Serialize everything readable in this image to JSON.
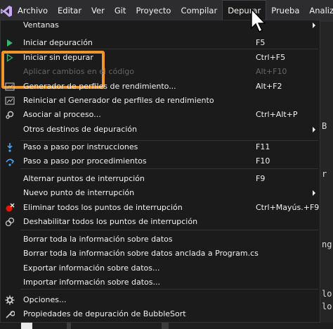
{
  "menubar": {
    "items": [
      "Archivo",
      "Editar",
      "Ver",
      "Git",
      "Proyecto",
      "Compilar",
      "Depurar",
      "Prueba",
      "Analiz"
    ],
    "active_index": 6
  },
  "editor_fragments": [
    "B",
    "r",
    "ng",
    "lo",
    "lo"
  ],
  "menu": {
    "items": [
      {
        "label": "Ventanas",
        "shortcut": "",
        "submenu": true,
        "icon": ""
      },
      {
        "label": "Iniciar depuración",
        "shortcut": "F5",
        "submenu": false,
        "icon": "play-icon"
      },
      {
        "label": "Iniciar sin depurar",
        "shortcut": "Ctrl+F5",
        "submenu": false,
        "icon": "play-outline-icon"
      },
      {
        "label": "Aplicar cambios en el código",
        "shortcut": "Alt+F10",
        "submenu": false,
        "icon": "",
        "disabled": true
      },
      {
        "label": "Generador de perfiles de rendimiento...",
        "shortcut": "Alt+F2",
        "submenu": false,
        "icon": "profiler-icon"
      },
      {
        "label": "Reiniciar el Generador de perfiles de rendimiento",
        "shortcut": "",
        "submenu": false,
        "icon": "profiler-restart-icon"
      },
      {
        "label": "Asociar al proceso...",
        "shortcut": "Ctrl+Alt+P",
        "submenu": false,
        "icon": "attach-process-icon"
      },
      {
        "label": "Otros destinos de depuración",
        "shortcut": "",
        "submenu": true,
        "icon": ""
      },
      {
        "label": "Paso a paso por instrucciones",
        "shortcut": "F11",
        "submenu": false,
        "icon": "step-into-icon"
      },
      {
        "label": "Paso a paso por procedimientos",
        "shortcut": "F10",
        "submenu": false,
        "icon": "step-over-icon"
      },
      {
        "label": "Alternar puntos de interrupción",
        "shortcut": "F9",
        "submenu": false,
        "icon": ""
      },
      {
        "label": "Nuevo punto de interrupción",
        "shortcut": "",
        "submenu": true,
        "icon": ""
      },
      {
        "label": "Eliminar todos los puntos de interrupción",
        "shortcut": "Ctrl+Mayús.+F9",
        "submenu": false,
        "icon": "delete-breakpoints-icon"
      },
      {
        "label": "Deshabilitar todos los puntos de interrupción",
        "shortcut": "",
        "submenu": false,
        "icon": "disable-breakpoints-icon"
      },
      {
        "label": "Borrar toda la información sobre datos",
        "shortcut": "",
        "submenu": false,
        "icon": ""
      },
      {
        "label": "Borrar toda la información sobre datos anclada a Program.cs",
        "shortcut": "",
        "submenu": false,
        "icon": ""
      },
      {
        "label": "Exportar información sobre datos...",
        "shortcut": "",
        "submenu": false,
        "icon": ""
      },
      {
        "label": "Importar información sobre datos...",
        "shortcut": "",
        "submenu": false,
        "icon": ""
      },
      {
        "label": "Opciones...",
        "shortcut": "",
        "submenu": false,
        "icon": "gear-icon"
      },
      {
        "label": "Propiedades de depuración de BubbleSort",
        "shortcut": "",
        "submenu": false,
        "icon": "wrench-icon"
      }
    ]
  },
  "colors": {
    "highlight_border": "#f3962a",
    "play_green": "#3cb371",
    "menu_bg": "#1b1b1c",
    "menubar_bg": "#2d2d30"
  }
}
